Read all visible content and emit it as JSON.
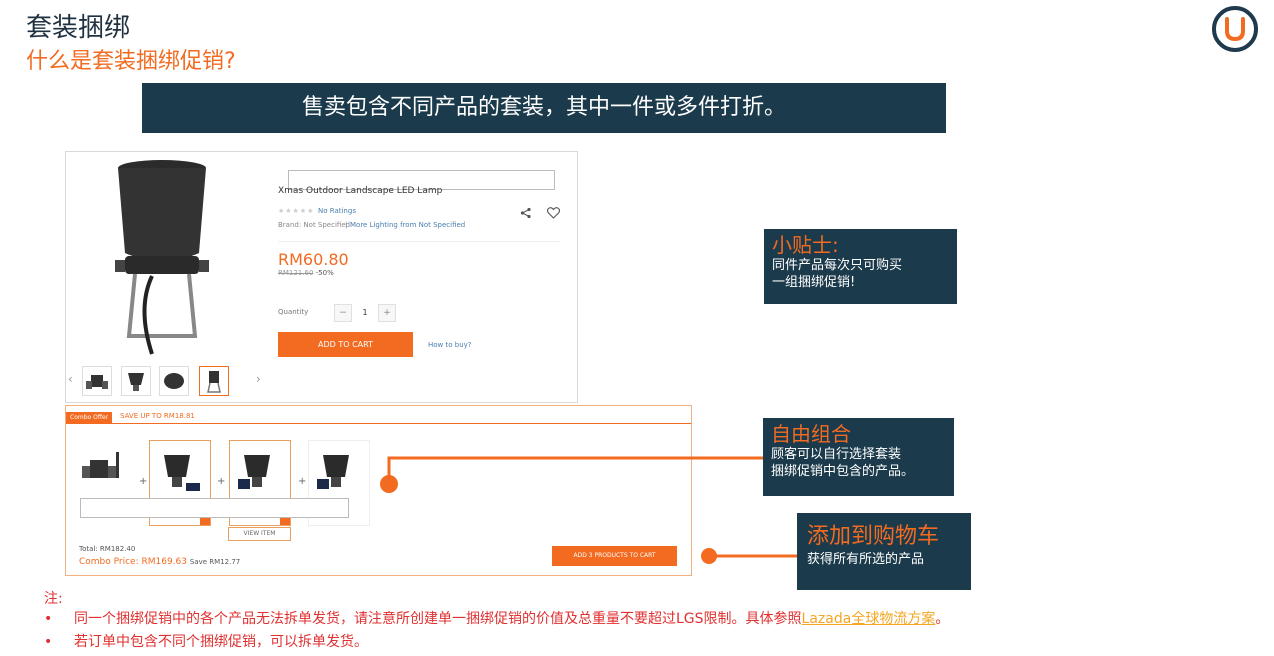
{
  "header": {
    "title": "套装捆绑",
    "subtitle": "什么是套装捆绑促销?"
  },
  "banner": {
    "text": "售卖包含不同产品的套装，其中一件或多件打折。"
  },
  "product": {
    "title_line2": "Xmas Outdoor Landscape LED Lamp",
    "rating_text": "No Ratings",
    "brand_text": "Brand: Not Specified",
    "more_link": "More Lighting from Not Specified",
    "price": "RM60.80",
    "old_price": "RM121.60",
    "discount": "-50%",
    "quantity_label": "Quantity",
    "quantity_value": "1",
    "minus": "−",
    "plus": "+",
    "add_to_cart": "ADD TO CART",
    "how_to_buy": "How to buy?",
    "prev_arrow": "‹",
    "next_arrow": "›"
  },
  "combo": {
    "tag": "Combo Offer",
    "save_up_to": "SAVE UP TO RM18.81",
    "plus_sign": "+",
    "view_item": "VIEW ITEM",
    "total": "Total: RM182.40",
    "combo_price_label": "Combo Price: RM169.63",
    "save_text": "Save RM12.77",
    "add_button": "ADD 3 PRODUCTS TO CART"
  },
  "callouts": {
    "tip_title": "小贴士:",
    "tip_line1": "同件产品每次只可购买",
    "tip_line2": "一组捆绑促销!",
    "free_title": "自由组合",
    "free_line1": "顾客可以自行选择套装",
    "free_line2": "捆绑促销中包含的产品。",
    "cart_title": "添加到购物车",
    "cart_line1": "获得所有所选的产品"
  },
  "notes": {
    "title": "注:",
    "bullet": "•",
    "note1_text": "同一个捆绑促销中的各个产品无法拆单发货，请注意所创建单一捆绑促销的价值及总重量不要超过LGS限制。具体参照",
    "note1_link": "Lazada全球物流方案",
    "note1_end": "。",
    "note2_text": "若订单中包含不同个捆绑促销，可以拆单发货。"
  },
  "colors": {
    "accent": "#f26b21",
    "navy": "#1b3a4b",
    "note_red": "#e03030"
  }
}
